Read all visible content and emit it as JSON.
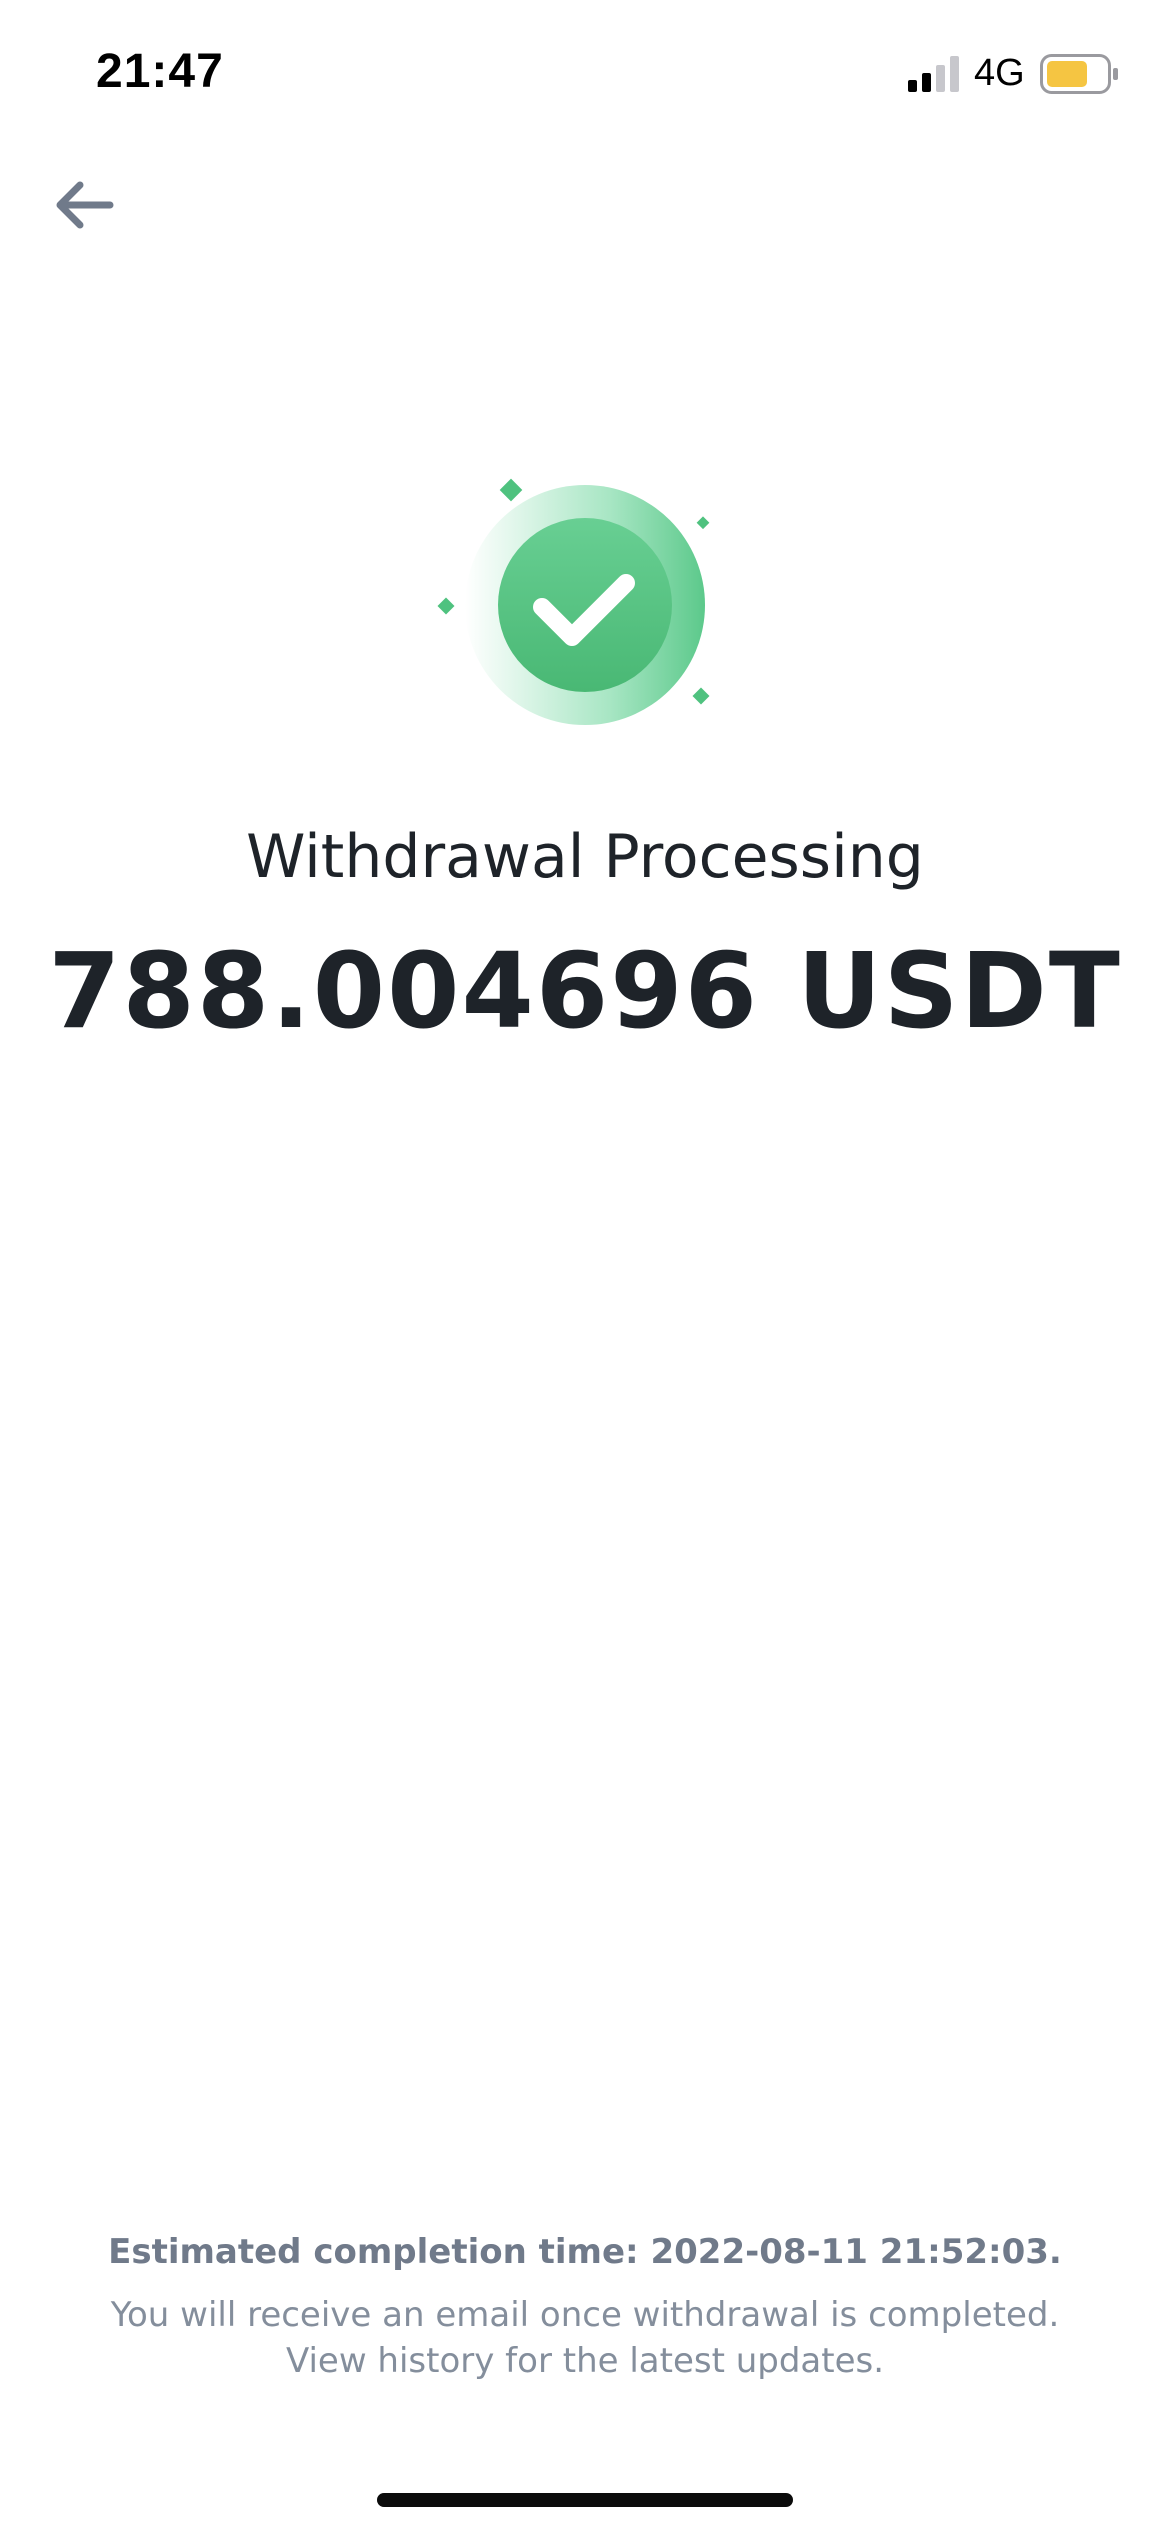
{
  "status_bar": {
    "time": "21:47",
    "network": "4G",
    "battery_color": "#f5c542"
  },
  "nav": {
    "back_icon": "arrow-left-icon"
  },
  "illustration": {
    "icon": "check-circle-icon",
    "accent_color": "#4fc27f"
  },
  "result": {
    "title": "Withdrawal Processing",
    "amount": "788.004696 USDT"
  },
  "footer": {
    "estimated": "Estimated completion time: 2022-08-11 21:52:03.",
    "notice_line1": "You will receive an email once withdrawal is completed.",
    "notice_line2": "View history for the latest updates."
  }
}
